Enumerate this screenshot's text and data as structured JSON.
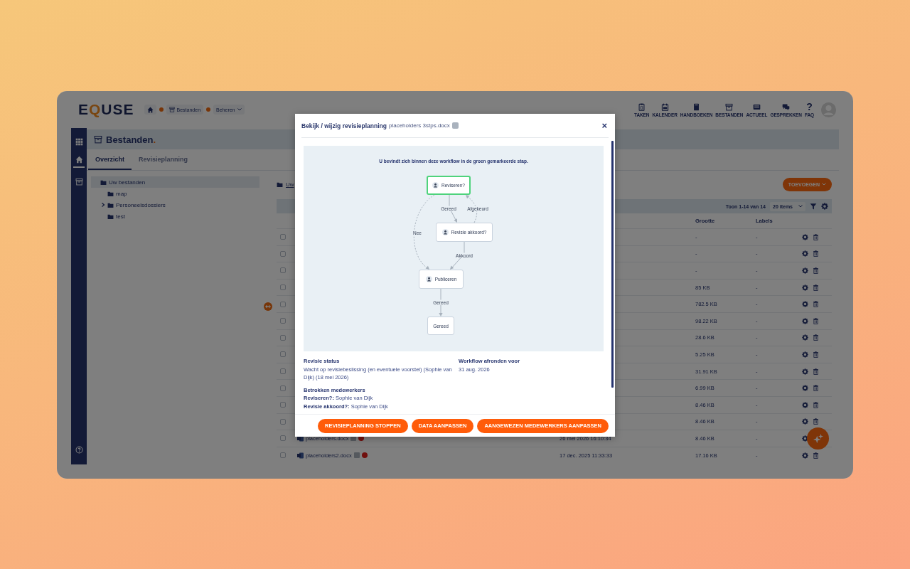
{
  "app": {
    "logo": {
      "before": "E",
      "accent": "Q",
      "after": "USE"
    },
    "breadcrumb": [
      {
        "kind": "home"
      },
      {
        "kind": "page",
        "label": "Bestanden"
      },
      {
        "kind": "menu",
        "label": "Beheren"
      }
    ],
    "nav": [
      {
        "label": "TAKEN"
      },
      {
        "label": "KALENDER"
      },
      {
        "label": "HANDBOEKEN"
      },
      {
        "label": "BESTANDEN"
      },
      {
        "label": "ACTUEEL"
      },
      {
        "label": "GESPREKKEN"
      },
      {
        "glyph": "?",
        "label": "FAQ"
      }
    ],
    "sidebar": [
      {
        "selected": false
      },
      {
        "selected": true
      },
      {
        "selected": false
      }
    ],
    "page_title": {
      "text": "Bestanden",
      "mark": "."
    },
    "tabs": [
      {
        "label": "Overzicht",
        "selected": true
      },
      {
        "label": "Revisieplanning",
        "selected": false
      }
    ],
    "tree": [
      {
        "label": "Uw bestanden",
        "selected": true,
        "children": [
          {
            "label": "map",
            "selected": false
          },
          {
            "label": "Personeelsdossiers",
            "selected": false,
            "expanded": false
          },
          {
            "label": "test",
            "selected": false
          }
        ]
      }
    ],
    "files": {
      "breadcrumb": "Uw",
      "add_button": "TOEVOEGEN",
      "range": "Toon 1-14 van 14",
      "page_size": "20 items",
      "columns": {
        "size": "Grootte",
        "labels": "Labels"
      },
      "rows": [
        {
          "checked": false,
          "size": "-",
          "labels": "-"
        },
        {
          "checked": false,
          "size": "-",
          "labels": "-"
        },
        {
          "checked": false,
          "size": "-",
          "labels": "-"
        },
        {
          "checked": false,
          "size": "85 KB",
          "labels": "-"
        },
        {
          "checked": false,
          "size": "782.5 KB",
          "labels": "-"
        },
        {
          "checked": false,
          "size": "98.22 KB",
          "labels": "-"
        },
        {
          "checked": false,
          "size": "28.6 KB",
          "labels": "-"
        },
        {
          "checked": false,
          "size": "5.25 KB",
          "labels": "-"
        },
        {
          "checked": false,
          "size": "31.91 KB",
          "labels": "-"
        },
        {
          "checked": false,
          "size": "6.99 KB",
          "labels": "-"
        },
        {
          "checked": false,
          "size": "8.46 KB",
          "labels": "-"
        },
        {
          "checked": false,
          "size": "8.46 KB",
          "labels": "-"
        },
        {
          "checked": false,
          "name": "placeholders.docx",
          "date": "26 mei 2026 16:10:34",
          "size": "8.46 KB",
          "labels": "-"
        },
        {
          "checked": false,
          "name": "placeholders2.docx",
          "date": "17 dec. 2025 11:33:33",
          "size": "17.16 KB",
          "labels": "-"
        }
      ]
    }
  },
  "modal": {
    "title": "Bekijk / wijzig revisieplanning",
    "file": "placeholders 3stps.docx",
    "close": "×",
    "workflow": {
      "caption": "U bevindt zich binnen deze workflow in de groen gemarkeerde stap.",
      "nodes": [
        {
          "kind": "task",
          "label": "Reviseren?",
          "current": true
        },
        {
          "kind": "task",
          "label": "Revisie akkoord?",
          "current": false
        },
        {
          "kind": "task",
          "label": "Publiceren",
          "current": false
        },
        {
          "kind": "end",
          "label": "Gereed",
          "current": false
        }
      ],
      "edges": [
        {
          "label": "Gereed",
          "dashed": false
        },
        {
          "label": "Afgekeurd",
          "dashed": true
        },
        {
          "label": "Nee",
          "dashed": true
        },
        {
          "label": "Akkoord",
          "dashed": false
        },
        {
          "label": "Gereed",
          "dashed": false
        }
      ]
    },
    "status": {
      "label": "Revisie status",
      "value": "Wacht op revisiebeslissing (en eventuele voorstel) (Sophie van Dijk) (18 mei 2026)"
    },
    "deadline": {
      "label": "Workflow afronden voor",
      "value": "31 aug. 2026"
    },
    "staff": {
      "label": "Betrokken medewerkers",
      "lines": [
        "**Reviseren?:** Sophie van Dijk",
        "**Revisie akkoord?:** Sophie van Dijk"
      ]
    },
    "buttons": [
      "REVISIEPLANNING STOPPEN",
      "DATA AANPASSEN",
      "AANGEWEZEN MEDEWERKERS AANPASSEN"
    ]
  }
}
